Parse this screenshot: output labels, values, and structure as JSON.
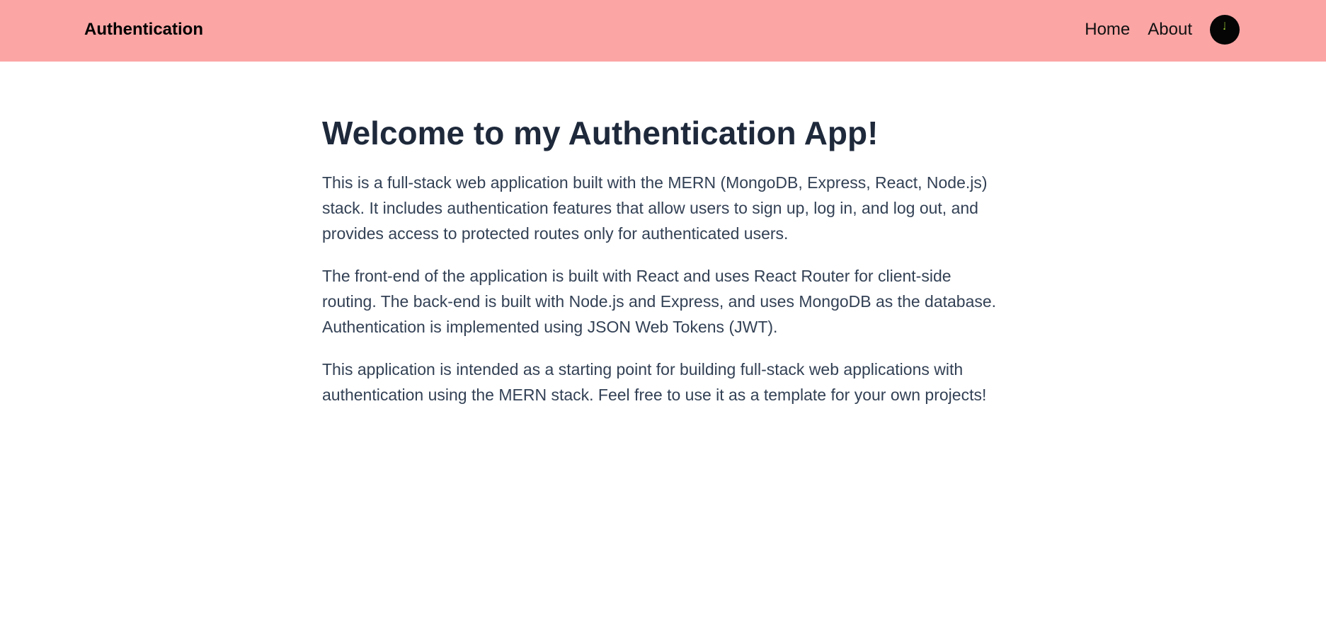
{
  "header": {
    "brand": "Authentication",
    "nav": [
      {
        "label": "Home"
      },
      {
        "label": "About"
      }
    ],
    "avatar_icon": "user-avatar-icon"
  },
  "main": {
    "title": "Welcome to my Authentication App!",
    "paragraphs": [
      "This is a full-stack web application built with the MERN (MongoDB, Express, React, Node.js) stack. It includes authentication features that allow users to sign up, log in, and log out, and provides access to protected routes only for authenticated users.",
      "The front-end of the application is built with React and uses React Router for client-side routing. The back-end is built with Node.js and Express, and uses MongoDB as the database. Authentication is implemented using JSON Web Tokens (JWT).",
      "This application is intended as a starting point for building full-stack web applications with authentication using the MERN stack. Feel free to use it as a template for your own projects!"
    ]
  },
  "colors": {
    "navbar_bg": "#fca5a5",
    "title_text": "#1e293b",
    "body_text": "#334155",
    "avatar_bg": "#050505"
  }
}
